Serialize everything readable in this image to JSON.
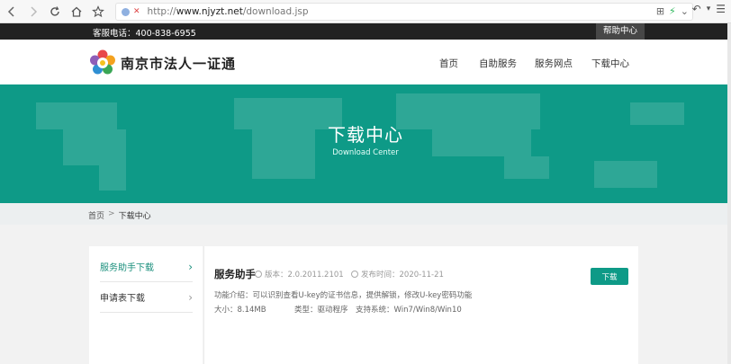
{
  "browser": {
    "url_scheme": "http://",
    "url_host": "www.njyzt.net",
    "url_path": "/download.jsp"
  },
  "topbar": {
    "phone": "客服电话：400-838-6955",
    "help": "帮助中心"
  },
  "header": {
    "logo_text": "南京市法人一证通",
    "nav": [
      "首页",
      "自助服务",
      "服务网点",
      "下载中心"
    ]
  },
  "banner": {
    "title": "下载中心",
    "subtitle": "Download Center",
    "bg_color": "#0e9a87"
  },
  "breadcrumb": {
    "home": "首页",
    "separator": ">",
    "current": "下载中心"
  },
  "sidebar": {
    "items": [
      {
        "label": "服务助手下载",
        "active": true
      },
      {
        "label": "申请表下载",
        "active": false
      }
    ]
  },
  "download_item": {
    "title": "服务助手",
    "version": "版本：2.0.2011.2101",
    "release_date": "发布时间：2020-11-21",
    "description": "功能介绍：可以识别查看U-key的证书信息，提供解锁，修改U-key密码功能",
    "size": "大小：8.14MB",
    "type": "类型：驱动程序",
    "systems": "支持系统：Win7/Win8/Win10",
    "button": "下载"
  },
  "colors": {
    "accent": "#0e9a87",
    "dark_strip": "#222222"
  }
}
